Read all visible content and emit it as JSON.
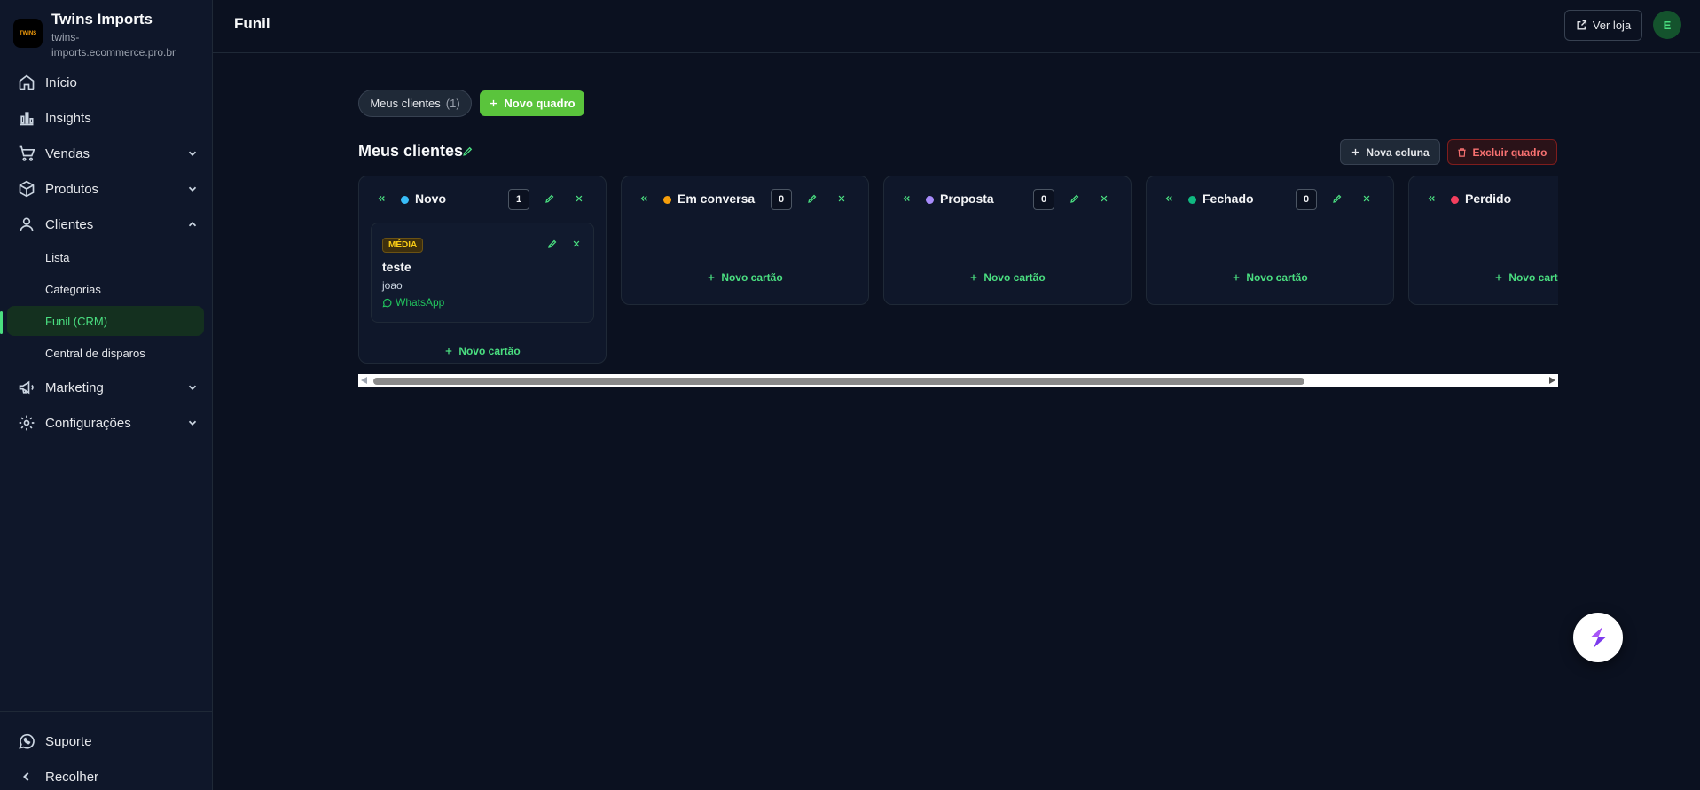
{
  "brand": {
    "name": "Twins Imports",
    "url": "twins-imports.ecommerce.pro.br",
    "logo_text": "TWINS"
  },
  "sidebar": {
    "items": [
      {
        "label": "Início",
        "icon": "home-icon"
      },
      {
        "label": "Insights",
        "icon": "bar-chart-icon"
      },
      {
        "label": "Vendas",
        "icon": "cart-icon"
      },
      {
        "label": "Produtos",
        "icon": "package-icon"
      },
      {
        "label": "Clientes",
        "icon": "user-icon"
      },
      {
        "label": "Marketing",
        "icon": "megaphone-icon"
      },
      {
        "label": "Configurações",
        "icon": "gear-icon"
      }
    ],
    "subitems": [
      {
        "label": "Lista"
      },
      {
        "label": "Categorias"
      },
      {
        "label": "Funil (CRM)",
        "active": true
      },
      {
        "label": "Central de disparos"
      }
    ],
    "bottom": [
      {
        "label": "Suporte",
        "icon": "whatsapp-icon"
      },
      {
        "label": "Recolher",
        "icon": "chevron-left-icon"
      }
    ]
  },
  "header": {
    "title": "Funil",
    "view_store": "Ver loja",
    "avatar_initial": "E"
  },
  "boards": {
    "chip_label": "Meus clientes",
    "chip_count": "(1)",
    "new_board": "Novo quadro"
  },
  "board": {
    "title": "Meus clientes",
    "new_column": "Nova coluna",
    "delete_board": "Excluir quadro",
    "add_card_label": "Novo cartão",
    "columns": [
      {
        "name": "Novo",
        "count": "1",
        "color": "#38bdf8"
      },
      {
        "name": "Em conversa",
        "count": "0",
        "color": "#f59e0b"
      },
      {
        "name": "Proposta",
        "count": "0",
        "color": "#a78bfa"
      },
      {
        "name": "Fechado",
        "count": "0",
        "color": "#10b981"
      },
      {
        "name": "Perdido",
        "count": "",
        "color": "#f43f5e"
      }
    ],
    "card": {
      "priority": "MÉDIA",
      "title": "teste",
      "contact": "joao",
      "channel": "WhatsApp"
    }
  },
  "colors": {
    "accent": "#5ac43c",
    "danger": "#f87171",
    "background": "#0b1120"
  }
}
